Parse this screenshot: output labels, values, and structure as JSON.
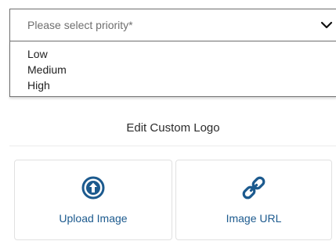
{
  "priority": {
    "placeholder": "Please select priority*",
    "options": [
      "Low",
      "Medium",
      "High"
    ]
  },
  "logo": {
    "title": "Edit Custom Logo",
    "upload_label": "Upload Image",
    "url_label": "Image URL"
  },
  "colors": {
    "accent": "#1c5a8e",
    "border": "#6e6e6e",
    "card_border": "#e1e1e1"
  },
  "icons": {
    "select_chevron": "chevron-down-icon",
    "upload": "upload-circle-arrow-icon",
    "url": "link-icon"
  }
}
